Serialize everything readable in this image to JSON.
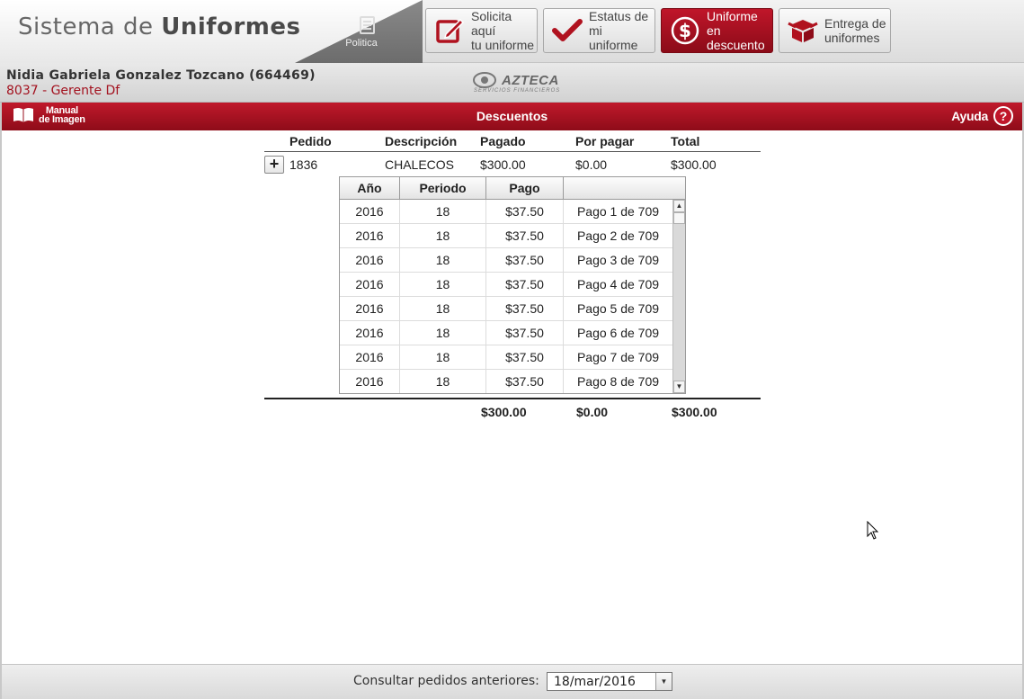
{
  "app": {
    "title_light": "Sistema de",
    "title_bold": "Uniformes",
    "politica_label": "Politica"
  },
  "nav": [
    {
      "label": "Solicita aquí\ntu uniforme",
      "icon": "edit-icon",
      "active": false
    },
    {
      "label": "Estatus de\nmi uniforme",
      "icon": "checkmark-icon",
      "active": false
    },
    {
      "label": "Uniforme en\ndescuento",
      "icon": "dollar-icon",
      "active": true
    },
    {
      "label": "Entrega de\nuniformes",
      "icon": "box-icon",
      "active": false
    }
  ],
  "user": {
    "name": "Nidia Gabriela Gonzalez Tozcano (664469)",
    "role": "8037 - Gerente Df"
  },
  "brand": {
    "name": "AZTECA",
    "subtitle": "SERVICIOS FINANCIEROS"
  },
  "section": {
    "manual_label": "Manual\nde Imagen",
    "title": "Descuentos",
    "help_label": "Ayuda",
    "help_glyph": "?"
  },
  "orders": {
    "columns": [
      "Pedido",
      "Descripción",
      "Pagado",
      "Por pagar",
      "Total"
    ],
    "rows": [
      {
        "expand": "+",
        "pedido": "1836",
        "descripcion": "CHALECOS",
        "pagado": "$300.00",
        "por_pagar": "$0.00",
        "total": "$300.00"
      }
    ],
    "totals": {
      "pagado": "$300.00",
      "por_pagar": "$0.00",
      "total": "$300.00"
    }
  },
  "payments": {
    "columns": [
      "Año",
      "Periodo",
      "Pago",
      ""
    ],
    "rows": [
      {
        "anio": "2016",
        "periodo": "18",
        "pago": "$37.50",
        "detalle": "Pago 1 de 709"
      },
      {
        "anio": "2016",
        "periodo": "18",
        "pago": "$37.50",
        "detalle": "Pago 2 de 709"
      },
      {
        "anio": "2016",
        "periodo": "18",
        "pago": "$37.50",
        "detalle": "Pago 3 de 709"
      },
      {
        "anio": "2016",
        "periodo": "18",
        "pago": "$37.50",
        "detalle": "Pago 4 de 709"
      },
      {
        "anio": "2016",
        "periodo": "18",
        "pago": "$37.50",
        "detalle": "Pago 5 de 709"
      },
      {
        "anio": "2016",
        "periodo": "18",
        "pago": "$37.50",
        "detalle": "Pago 6 de 709"
      },
      {
        "anio": "2016",
        "periodo": "18",
        "pago": "$37.50",
        "detalle": "Pago 7 de 709"
      },
      {
        "anio": "2016",
        "periodo": "18",
        "pago": "$37.50",
        "detalle": "Pago 8 de 709"
      }
    ]
  },
  "footer": {
    "label": "Consultar pedidos anteriores:",
    "selected_date": "18/mar/2016"
  },
  "colors": {
    "brand_red": "#b0121f",
    "user_role": "#a3121f"
  }
}
